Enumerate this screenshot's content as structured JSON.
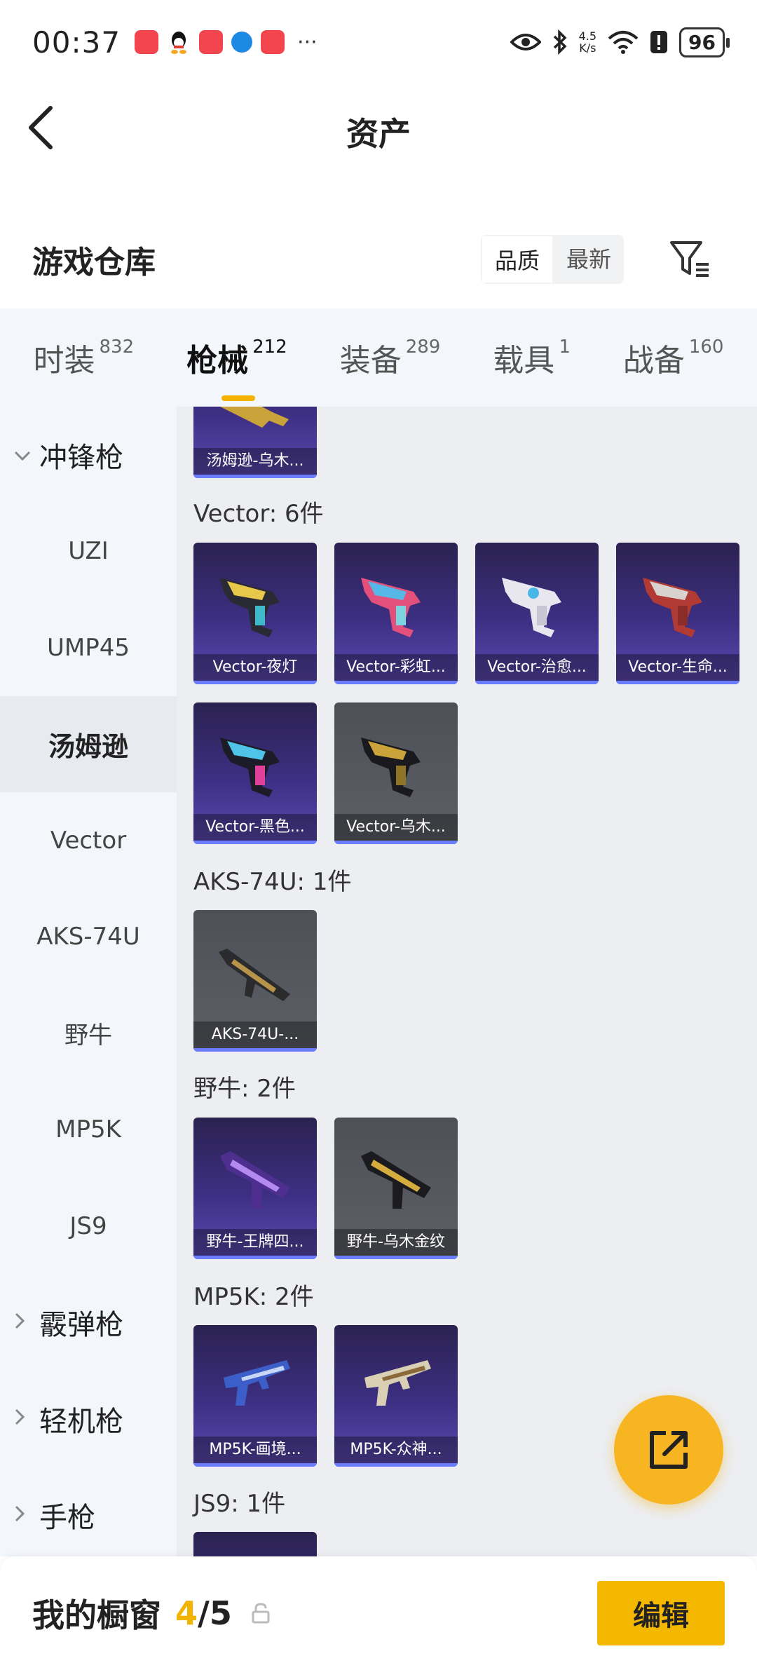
{
  "status_bar": {
    "time": "00:37",
    "more": "···",
    "speed_value": "4.5",
    "speed_unit": "K/s",
    "battery": "96"
  },
  "header": {
    "title": "资产"
  },
  "warehouse": {
    "title": "游戏仓库",
    "sort_options": [
      "品质",
      "最新"
    ],
    "sort_selected": "品质"
  },
  "tabs": [
    {
      "label": "时装",
      "count": "832"
    },
    {
      "label": "枪械",
      "count": "212"
    },
    {
      "label": "装备",
      "count": "289"
    },
    {
      "label": "载具",
      "count": "1"
    },
    {
      "label": "战备",
      "count": "160"
    }
  ],
  "tabs_active": "枪械",
  "sidebar": {
    "smg_group": "冲锋枪",
    "items": [
      "UZI",
      "UMP45",
      "汤姆逊",
      "Vector",
      "AKS-74U",
      "野牛",
      "MP5K",
      "JS9"
    ],
    "active_item": "汤姆逊",
    "groups_after": [
      "霰弹枪",
      "轻机枪",
      "手枪"
    ]
  },
  "content": {
    "partial_card": "汤姆逊-乌木...",
    "sections": [
      {
        "label": "Vector: 6件",
        "cards": [
          "Vector-夜灯",
          "Vector-彩虹...",
          "Vector-治愈...",
          "Vector-生命...",
          "Vector-黑色...",
          "Vector-乌木..."
        ]
      },
      {
        "label": "AKS-74U: 1件",
        "cards": [
          "AKS-74U-..."
        ]
      },
      {
        "label": "野牛: 2件",
        "cards": [
          "野牛-王牌四...",
          "野牛-乌木金纹"
        ]
      },
      {
        "label": "MP5K: 2件",
        "cards": [
          "MP5K-画境...",
          "MP5K-众神..."
        ]
      },
      {
        "label": "JS9: 1件",
        "cards": []
      }
    ]
  },
  "bottom_bar": {
    "title": "我的橱窗",
    "count_current": "4",
    "count_total": "/5",
    "edit_label": "编辑"
  },
  "colors": {
    "accent": "#f5b800",
    "tab_underline": "#f5b100",
    "card_purple": "#3d2f83",
    "card_gray": "#555860"
  }
}
